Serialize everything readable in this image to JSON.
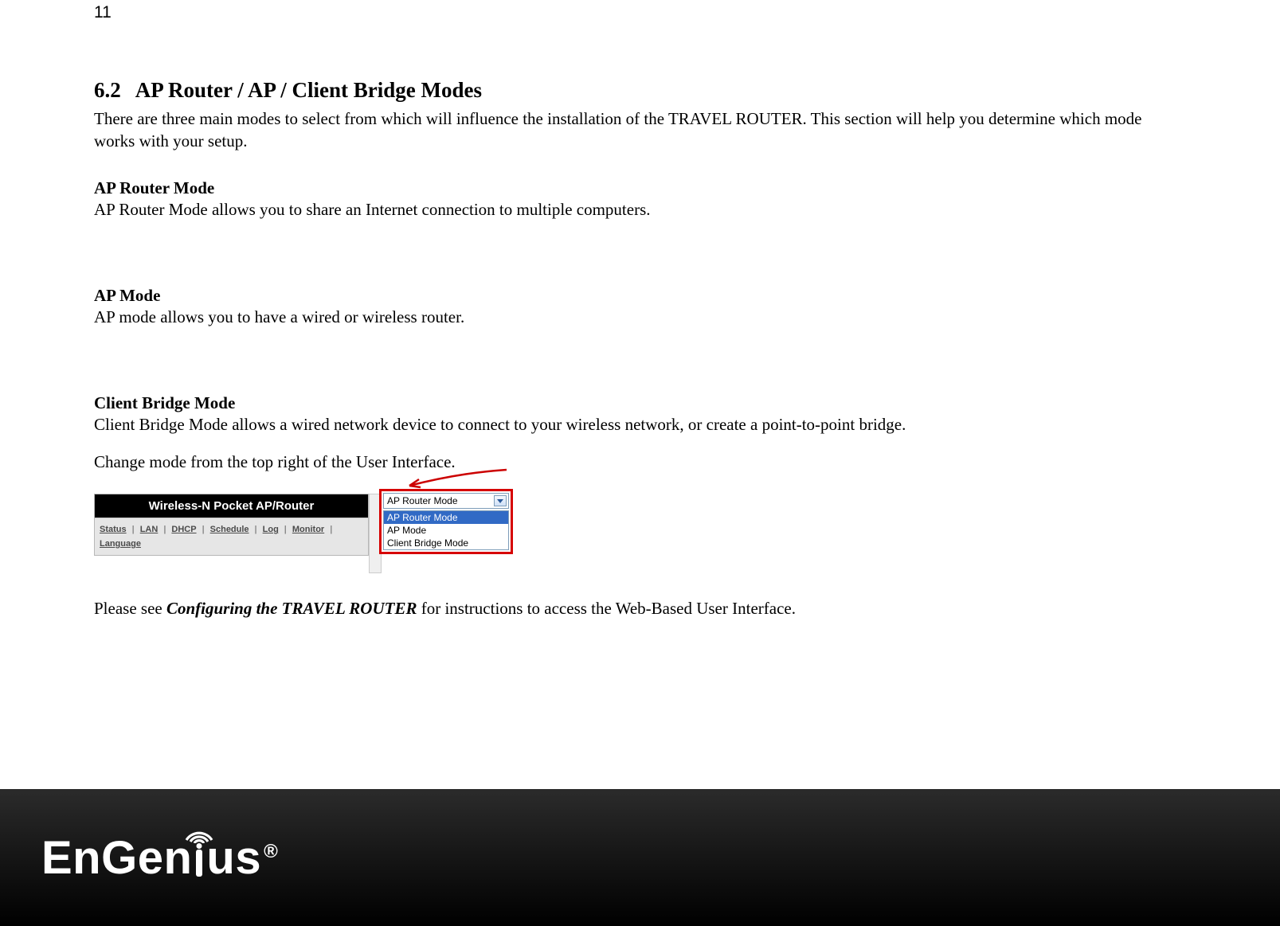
{
  "page_number": "11",
  "heading": {
    "number": "6.2",
    "title": "AP Router / AP / Client Bridge Modes"
  },
  "intro": "There are three main modes to select from which will influence the installation of the TRAVEL ROUTER. This section will help you determine which mode works with your setup.",
  "modes": {
    "ap_router": {
      "head": "AP Router Mode",
      "body": "AP Router Mode allows you to share an Internet connection to multiple computers."
    },
    "ap": {
      "head": "AP Mode",
      "body": "AP mode allows you to have a wired or wireless router."
    },
    "client_bridge": {
      "head": "Client Bridge Mode",
      "body": "Client Bridge Mode allows a wired network device to connect to your wireless network, or create a point-to-point bridge."
    }
  },
  "change_hint": "Change mode from the top right of the User Interface.",
  "ui": {
    "title": "Wireless-N Pocket AP/Router",
    "nav": {
      "status": "Status",
      "lan": "LAN",
      "dhcp": "DHCP",
      "schedule": "Schedule",
      "log": "Log",
      "monitor": "Monitor",
      "language": "Language"
    },
    "mode_dropdown": {
      "selected": "AP Router Mode",
      "options": {
        "ap_router": "AP Router Mode",
        "ap": "AP Mode",
        "client_bridge": "Client Bridge Mode"
      }
    }
  },
  "footnote": {
    "pre": "Please see ",
    "link": "Configuring the TRAVEL ROUTER",
    "post": " for instructions to access the Web-Based User Interface."
  },
  "brand": {
    "name": "EnGenius",
    "reg": "®"
  }
}
